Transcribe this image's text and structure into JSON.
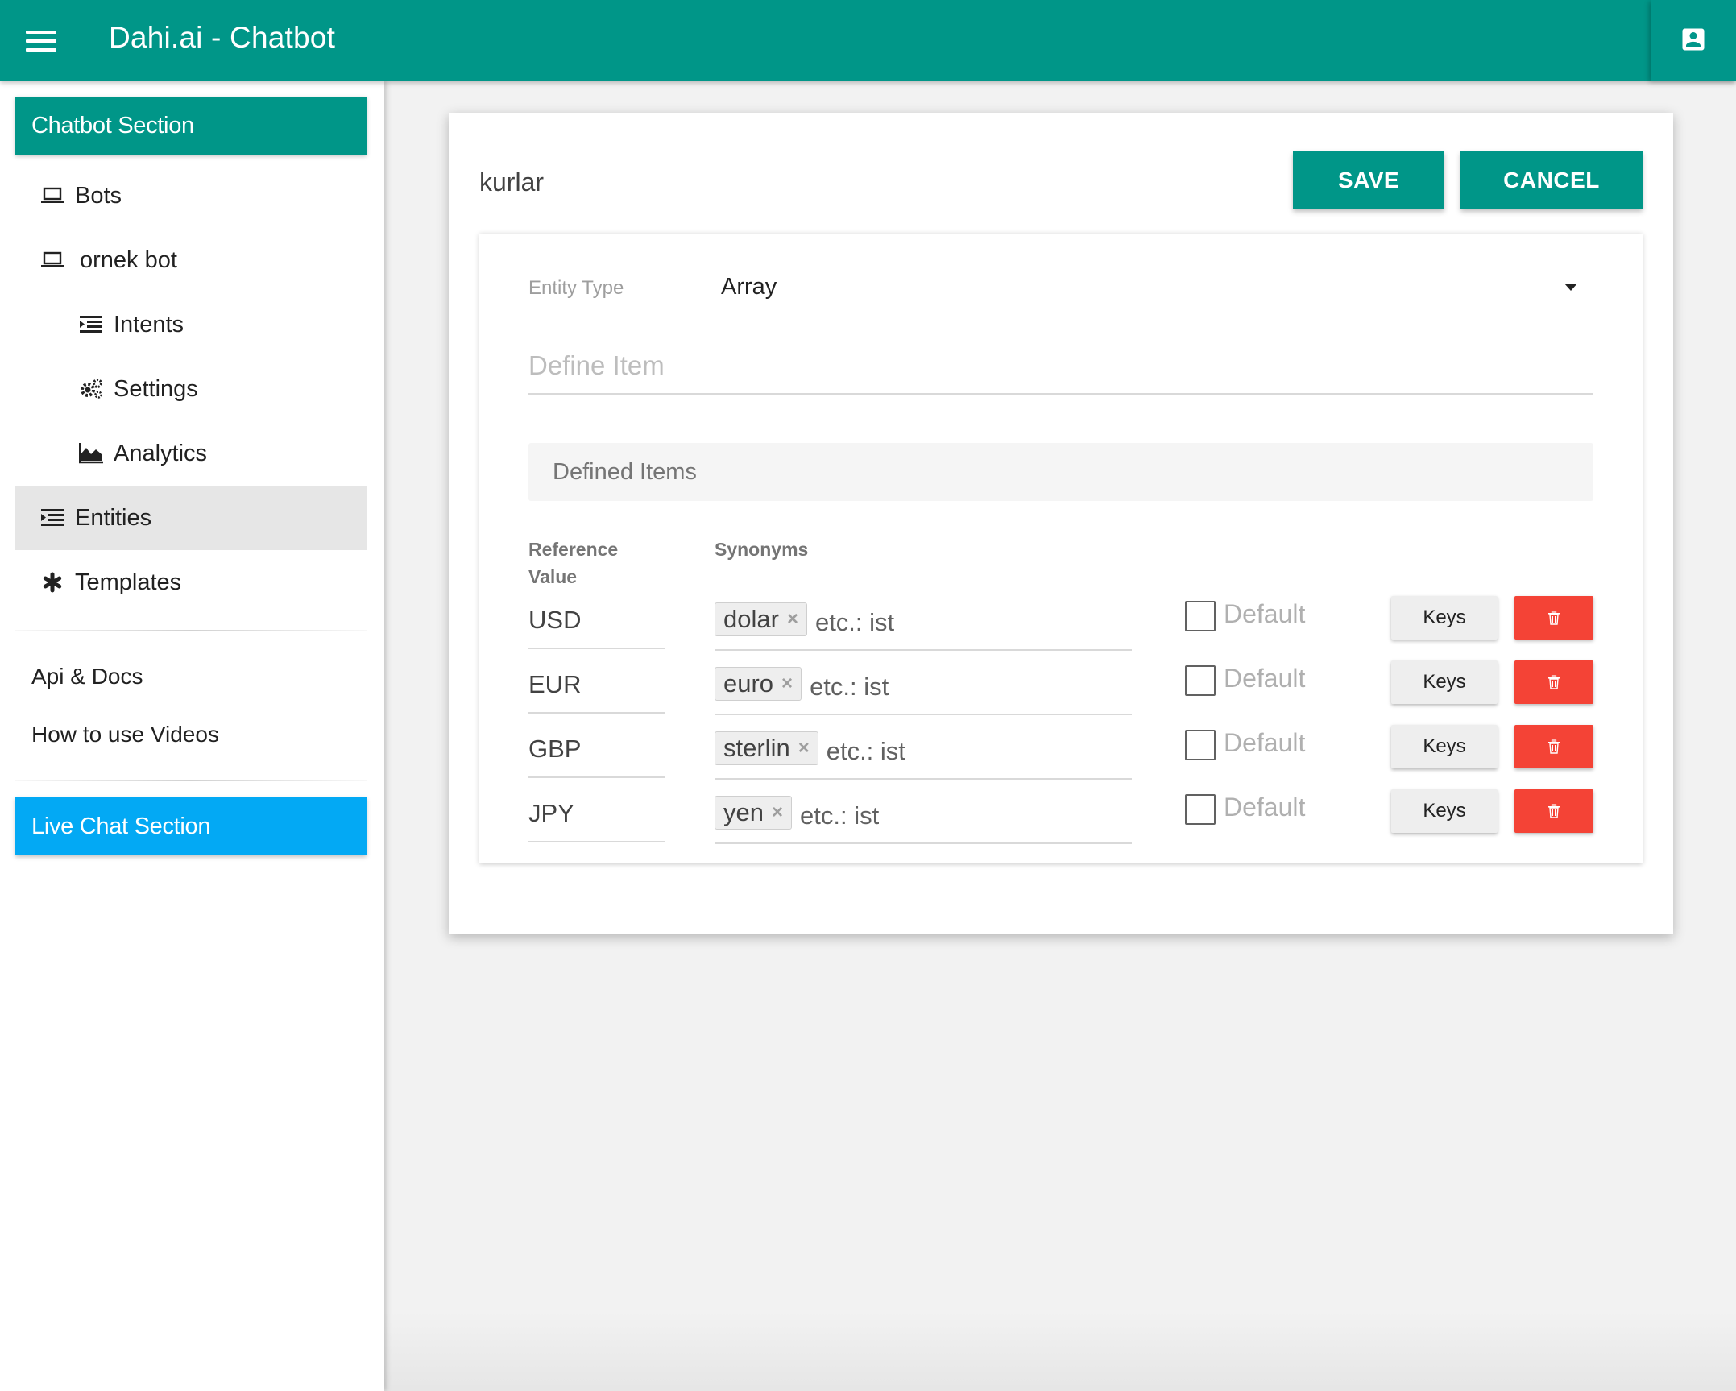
{
  "header": {
    "title": "Dahi.ai - Chatbot",
    "menu_icon": "hamburger-menu-icon",
    "profile_icon": "account-box-icon",
    "color": "#009688"
  },
  "sidebar": {
    "chatbot_section": "Chatbot Section",
    "live_chat_section": "Live Chat Section",
    "items": [
      {
        "label": "Bots",
        "icon": "laptop-icon"
      },
      {
        "label": "ornek bot",
        "icon": "laptop-icon"
      },
      {
        "label": "Intents",
        "icon": "list-indent-icon"
      },
      {
        "label": "Settings",
        "icon": "gears-icon"
      },
      {
        "label": "Analytics",
        "icon": "area-chart-icon"
      },
      {
        "label": "Entities",
        "icon": "list-indent-icon"
      },
      {
        "label": "Templates",
        "icon": "asterisk-icon"
      }
    ],
    "links": [
      "Api & Docs",
      "How to use Videos"
    ],
    "active": "Entities",
    "live_color": "#03a9f4"
  },
  "entity": {
    "name": "kurlar",
    "save_label": "SAVE",
    "cancel_label": "CANCEL",
    "type_label": "Entity Type",
    "type_value": "Array",
    "define_placeholder": "Define Item",
    "defined_items_label": "Defined Items",
    "col_reference_line1": "Reference",
    "col_reference_line2": "Value",
    "col_synonyms": "Synonyms",
    "synonym_placeholder": "etc.: ist",
    "default_label": "Default",
    "keys_label": "Keys",
    "delete_color": "#f44336",
    "rows": [
      {
        "reference": "USD",
        "synonyms": [
          "dolar"
        ],
        "default": false
      },
      {
        "reference": "EUR",
        "synonyms": [
          "euro"
        ],
        "default": false
      },
      {
        "reference": "GBP",
        "synonyms": [
          "sterlin"
        ],
        "default": false
      },
      {
        "reference": "JPY",
        "synonyms": [
          "yen"
        ],
        "default": false
      }
    ]
  }
}
